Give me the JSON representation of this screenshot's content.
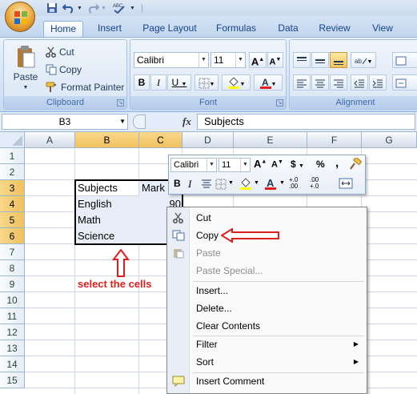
{
  "namebox": {
    "value": "B3"
  },
  "formula": {
    "fx": "fx",
    "content": "Subjects"
  },
  "tabs": [
    "Home",
    "Insert",
    "Page Layout",
    "Formulas",
    "Data",
    "Review",
    "View"
  ],
  "ribbon": {
    "clipboard": {
      "label": "Clipboard",
      "paste": "Paste",
      "cut": "Cut",
      "copy": "Copy",
      "format_painter": "Format Painter"
    },
    "font": {
      "label": "Font",
      "font_name": "Calibri",
      "font_size": "11",
      "bold": "B",
      "italic": "I",
      "underline": "U"
    },
    "alignment": {
      "label": "Alignment"
    }
  },
  "columns": [
    "A",
    "B",
    "C",
    "D",
    "E",
    "F",
    "G"
  ],
  "rows": [
    "1",
    "2",
    "3",
    "4",
    "5",
    "6",
    "7",
    "8",
    "9",
    "10",
    "11",
    "12",
    "13",
    "14",
    "15"
  ],
  "cells": {
    "b3": "Subjects",
    "c3": "Mark",
    "b4": "English",
    "c4": "90",
    "b5": "Math",
    "b6": "Science"
  },
  "mini_toolbar": {
    "font_name": "Calibri",
    "font_size": "11",
    "bold": "B",
    "italic": "I",
    "currency": "$",
    "percent": "%",
    "comma": ",",
    "dec_inc": "+.0 .00",
    "dec_dec": ".00 +.0"
  },
  "context_menu": {
    "cut": "Cut",
    "copy": "Copy",
    "paste": "Paste",
    "paste_special": "Paste Special...",
    "insert": "Insert...",
    "delete": "Delete...",
    "clear_contents": "Clear Contents",
    "filter": "Filter",
    "sort": "Sort",
    "insert_comment": "Insert Comment"
  },
  "annotation": "select the cells",
  "colors": {
    "annotation_red": "#e01e1e",
    "selection_header": "#f1c15f",
    "ribbon_blue": "#c9dbf1"
  }
}
